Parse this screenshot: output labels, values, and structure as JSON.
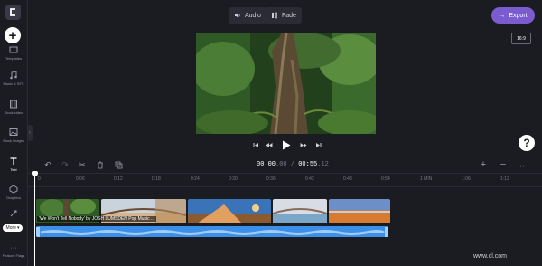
{
  "sidebar": {
    "logo": "C",
    "items": [
      {
        "label": "Templates"
      },
      {
        "label": "Music & SFX"
      },
      {
        "label": "Stock video"
      },
      {
        "label": "Stock images"
      },
      {
        "label": "Text"
      },
      {
        "label": "Graphics"
      },
      {
        "label": "Transitions"
      },
      {
        "label": "Feature Flags"
      }
    ],
    "more_label": "More"
  },
  "toolbar": {
    "audio_label": "Audio",
    "fade_label": "Fade",
    "export_label": "Export"
  },
  "aspect_ratio": "16:9",
  "help_label": "?",
  "timecode": {
    "current": "00:00",
    "current_frames": "00",
    "total": "00:55",
    "total_frames": "12"
  },
  "ruler_ticks": [
    "0",
    "0:06",
    "0:12",
    "0:18",
    "0:24",
    "0:30",
    "0:36",
    "0:42",
    "0:48",
    "0:54",
    "1 MIN",
    "1:06",
    "1:12"
  ],
  "clip_label": "'We Won't Tell Nobody' by JOSH LUMSDEN Pop Music ...",
  "watermark": "www.cl.com",
  "colors": {
    "accent": "#7b5ccf",
    "audio_track": "#3b8fe6",
    "background": "#1b1b22"
  }
}
